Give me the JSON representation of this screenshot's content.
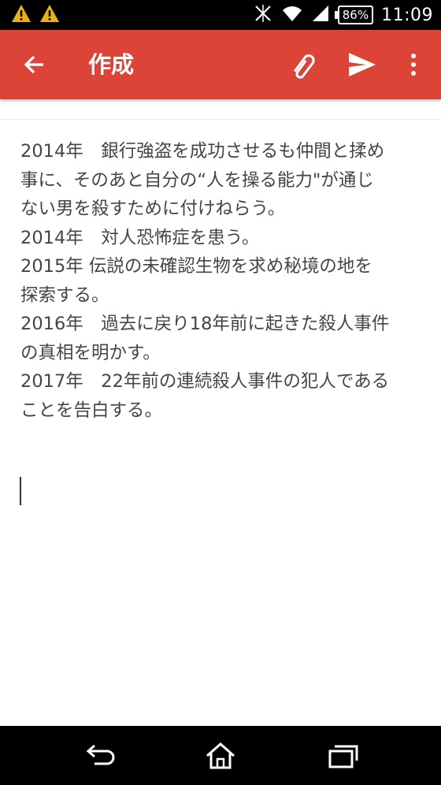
{
  "status_bar": {
    "icons": [
      "warning-icon",
      "warning-icon",
      "no-signal-icon",
      "wifi-icon",
      "cell-signal-icon"
    ],
    "battery": "86%",
    "time": "11:09"
  },
  "app_bar": {
    "title": "作成",
    "color": "#dc4437",
    "icons": [
      "back-arrow-icon",
      "paperclip-icon",
      "send-icon",
      "overflow-menu-icon"
    ]
  },
  "compose": {
    "lines": [
      "2014年　銀行強盗を成功させるも仲間と揉め",
      "事に、そのあと自分の“人を操る能力\"が通じ",
      "ない男を殺すために付けねらう。",
      "2014年　対人恐怖症を患う。",
      "2015年 伝説の未確認生物を求め秘境の地を",
      "探索する。",
      "2016年　過去に戻り18年前に起きた殺人事件",
      "の真相を明かす。",
      "2017年　22年前の連続殺人事件の犯人である",
      "ことを告白する。"
    ]
  },
  "nav_bar": {
    "icons": [
      "back-icon",
      "home-icon",
      "recent-apps-icon"
    ]
  }
}
